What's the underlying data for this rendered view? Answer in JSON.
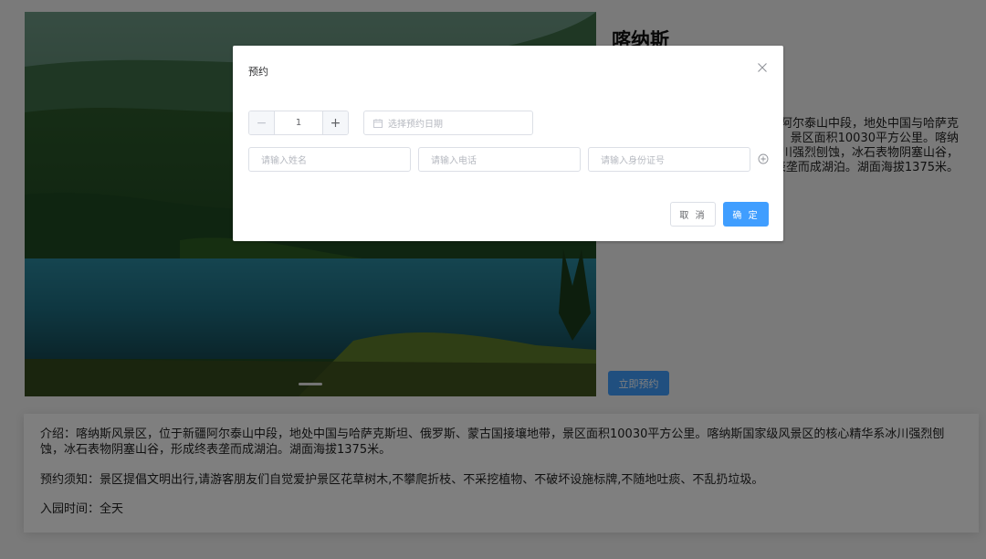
{
  "scenic": {
    "title": "喀纳斯",
    "summary": "介绍：喀纳斯风景区，位于新疆阿尔泰山中段，地处中国与哈萨克斯坦、俄罗斯、蒙古国接壤地带，景区面积10030平方公里。喀纳斯国家级风景区的核心精华系冰川强烈刨蚀，冰石表物阴塞山谷，形成终表垄而成湖泊。湖面海拔1375米。",
    "book_button": "立即预约"
  },
  "info": {
    "intro": "介绍：喀纳斯风景区，位于新疆阿尔泰山中段，地处中国与哈萨克斯坦、俄罗斯、蒙古国接壤地带，景区面积10030平方公里。喀纳斯国家级风景区的核心精华系冰川强烈刨蚀，冰石表物阴塞山谷，形成终表垄而成湖泊。湖面海拔1375米。",
    "notice": "预约须知：景区提倡文明出行,请游客朋友们自觉爱护景区花草树木,不攀爬折枝、不采挖植物、不破坏设施标牌,不随地吐痰、不乱扔垃圾。",
    "hours": "入园时间：全天"
  },
  "dialog": {
    "title": "预约",
    "quantity": "1",
    "minus_symbol": "−",
    "plus_symbol": "+",
    "date_placeholder": "选择预约日期",
    "name_placeholder": "请输入姓名",
    "phone_placeholder": "请输入电话",
    "id_placeholder": "请输入身份证号",
    "cancel_label": "取 消",
    "confirm_label": "确 定"
  },
  "icons": {
    "close": "close-icon",
    "calendar": "calendar-icon",
    "add": "circle-plus-icon"
  },
  "colors": {
    "primary": "#409eff",
    "mask": "rgba(0,0,0,0.5)"
  }
}
